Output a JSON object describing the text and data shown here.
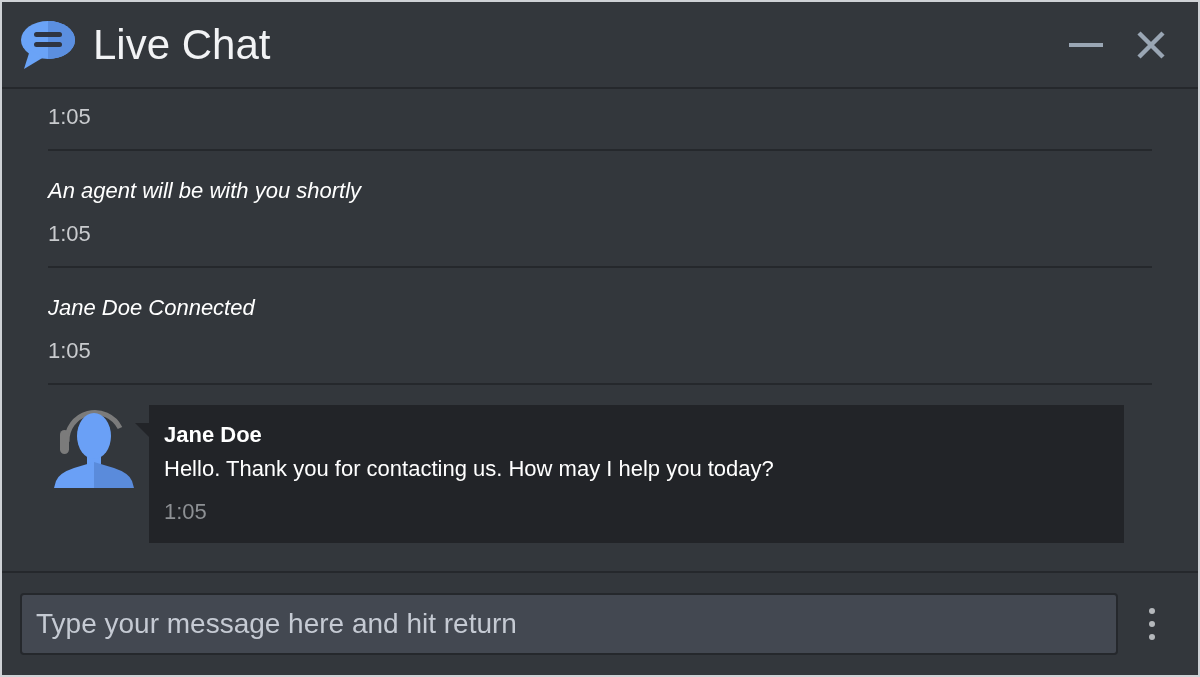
{
  "window": {
    "title": "Live Chat"
  },
  "messages": [
    {
      "kind": "system",
      "time": "1:05"
    },
    {
      "kind": "system",
      "text": "An agent will be with you shortly",
      "time": "1:05"
    },
    {
      "kind": "system",
      "text": "Jane Doe Connected",
      "time": "1:05"
    },
    {
      "kind": "agent",
      "sender": "Jane Doe",
      "text": "Hello. Thank you for contacting us. How may I help you today?",
      "time": "1:05"
    }
  ],
  "composer": {
    "placeholder": "Type your message here and hit return"
  }
}
